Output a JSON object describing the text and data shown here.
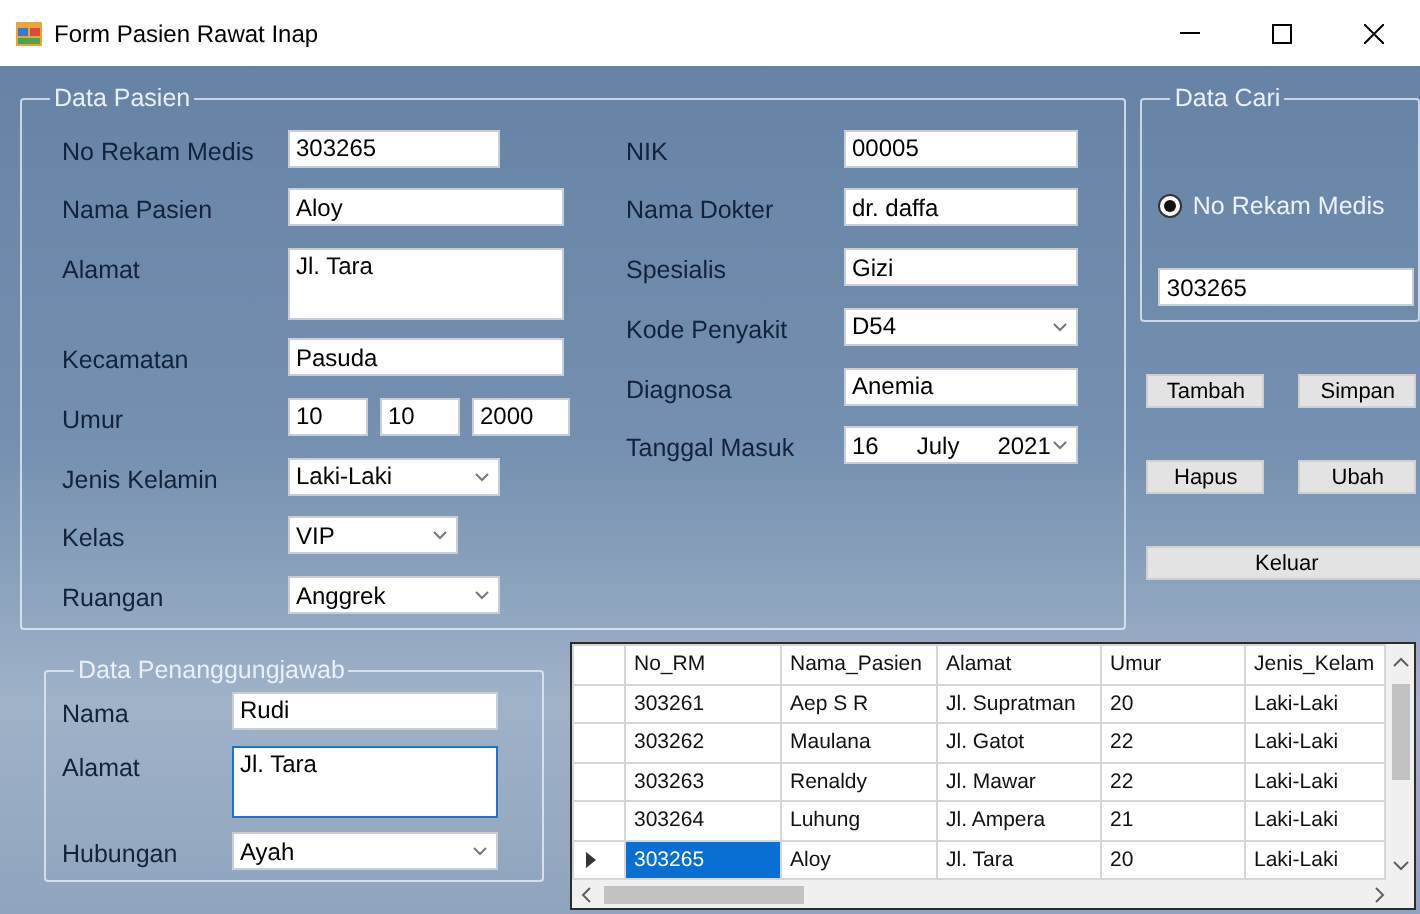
{
  "window": {
    "title": "Form Pasien Rawat Inap"
  },
  "data_pasien": {
    "legend": "Data Pasien",
    "left_fields": [
      {
        "kind": "text",
        "label": "No Rekam Medis",
        "value": "303265"
      },
      {
        "kind": "text",
        "label": "Nama Pasien",
        "value": "Aloy"
      },
      {
        "kind": "textarea",
        "label": "Alamat",
        "value": "Jl. Tara"
      },
      {
        "kind": "text",
        "label": "Kecamatan",
        "value": "Pasuda"
      },
      {
        "kind": "triple",
        "label": "Umur",
        "values": [
          "10",
          "10",
          "2000"
        ]
      },
      {
        "kind": "combo",
        "label": "Jenis Kelamin",
        "value": "Laki-Laki"
      },
      {
        "kind": "combo",
        "label": "Kelas",
        "value": "VIP"
      },
      {
        "kind": "combo",
        "label": "Ruangan",
        "value": "Anggrek"
      }
    ],
    "right_fields": [
      {
        "kind": "text",
        "label": "NIK",
        "value": "00005"
      },
      {
        "kind": "text",
        "label": "Nama Dokter",
        "value": "dr. daffa"
      },
      {
        "kind": "text",
        "label": "Spesialis",
        "value": "Gizi"
      },
      {
        "kind": "combo",
        "label": "Kode Penyakit",
        "value": "D54"
      },
      {
        "kind": "text",
        "label": "Diagnosa",
        "value": "Anemia"
      },
      {
        "kind": "date",
        "label": "Tanggal Masuk",
        "parts": [
          "16",
          "July",
          "2021"
        ]
      }
    ]
  },
  "data_cari": {
    "legend": "Data Cari",
    "option": {
      "label": "No Rekam Medis",
      "selected": true
    },
    "value": "303265"
  },
  "buttons": [
    {
      "kind": "half",
      "label": "Tambah"
    },
    {
      "kind": "half",
      "label": "Simpan"
    },
    {
      "kind": "half",
      "label": "Hapus"
    },
    {
      "kind": "half",
      "label": "Ubah"
    },
    {
      "kind": "wide",
      "label": "Keluar"
    }
  ],
  "penanggungjawab": {
    "legend": "Data Penanggungjawab",
    "fields": [
      {
        "kind": "text",
        "label": "Nama",
        "value": "Rudi",
        "focused": false
      },
      {
        "kind": "textarea",
        "label": "Alamat",
        "value": "Jl. Tara",
        "focused": true
      },
      {
        "kind": "combo",
        "label": "Hubungan",
        "value": "Ayah",
        "focused": false
      }
    ]
  },
  "table": {
    "columns": [
      "No_RM",
      "Nama_Pasien",
      "Alamat",
      "Umur",
      "Jenis_Kelam"
    ],
    "rows": [
      {
        "cells": [
          "303261",
          "Aep S R",
          "Jl. Supratman",
          "20",
          "Laki-Laki"
        ],
        "selected": false
      },
      {
        "cells": [
          "303262",
          "Maulana",
          "Jl. Gatot",
          "22",
          "Laki-Laki"
        ],
        "selected": false
      },
      {
        "cells": [
          "303263",
          "Renaldy",
          "Jl. Mawar",
          "22",
          "Laki-Laki"
        ],
        "selected": false
      },
      {
        "cells": [
          "303264",
          "Luhung",
          "Jl. Ampera",
          "21",
          "Laki-Laki"
        ],
        "selected": false
      },
      {
        "cells": [
          "303265",
          "Aloy",
          "Jl. Tara",
          "20",
          "Laki-Laki"
        ],
        "selected": true
      }
    ]
  }
}
